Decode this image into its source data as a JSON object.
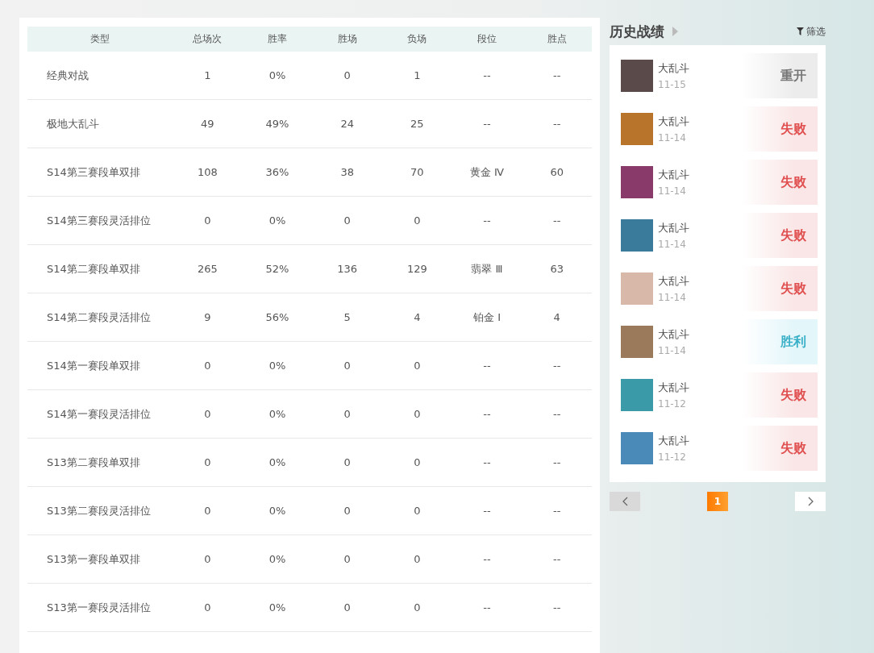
{
  "table": {
    "columns": [
      "类型",
      "总场次",
      "胜率",
      "胜场",
      "负场",
      "段位",
      "胜点"
    ],
    "rows": [
      [
        "经典对战",
        "1",
        "0%",
        "0",
        "1",
        "--",
        "--"
      ],
      [
        "极地大乱斗",
        "49",
        "49%",
        "24",
        "25",
        "--",
        "--"
      ],
      [
        "S14第三赛段单双排",
        "108",
        "36%",
        "38",
        "70",
        "黄金 Ⅳ",
        "60"
      ],
      [
        "S14第三赛段灵活排位",
        "0",
        "0%",
        "0",
        "0",
        "--",
        "--"
      ],
      [
        "S14第二赛段单双排",
        "265",
        "52%",
        "136",
        "129",
        "翡翠 Ⅲ",
        "63"
      ],
      [
        "S14第二赛段灵活排位",
        "9",
        "56%",
        "5",
        "4",
        "铂金 Ⅰ",
        "4"
      ],
      [
        "S14第一赛段单双排",
        "0",
        "0%",
        "0",
        "0",
        "--",
        "--"
      ],
      [
        "S14第一赛段灵活排位",
        "0",
        "0%",
        "0",
        "0",
        "--",
        "--"
      ],
      [
        "S13第二赛段单双排",
        "0",
        "0%",
        "0",
        "0",
        "--",
        "--"
      ],
      [
        "S13第二赛段灵活排位",
        "0",
        "0%",
        "0",
        "0",
        "--",
        "--"
      ],
      [
        "S13第一赛段单双排",
        "0",
        "0%",
        "0",
        "0",
        "--",
        "--"
      ],
      [
        "S13第一赛段灵活排位",
        "0",
        "0%",
        "0",
        "0",
        "--",
        "--"
      ]
    ]
  },
  "history": {
    "title": "历史战绩",
    "filter": "筛选",
    "matches": [
      {
        "mode": "大乱斗",
        "date": "11-15",
        "result": "重开",
        "kind": "remake",
        "color": "#5a4a4a"
      },
      {
        "mode": "大乱斗",
        "date": "11-14",
        "result": "失败",
        "kind": "loss",
        "color": "#b8742a"
      },
      {
        "mode": "大乱斗",
        "date": "11-14",
        "result": "失败",
        "kind": "loss",
        "color": "#8a3a6a"
      },
      {
        "mode": "大乱斗",
        "date": "11-14",
        "result": "失败",
        "kind": "loss",
        "color": "#3a7a9a"
      },
      {
        "mode": "大乱斗",
        "date": "11-14",
        "result": "失败",
        "kind": "loss",
        "color": "#d8b8a8"
      },
      {
        "mode": "大乱斗",
        "date": "11-14",
        "result": "胜利",
        "kind": "win",
        "color": "#9a7a5a"
      },
      {
        "mode": "大乱斗",
        "date": "11-12",
        "result": "失败",
        "kind": "loss",
        "color": "#3a9aa8"
      },
      {
        "mode": "大乱斗",
        "date": "11-12",
        "result": "失败",
        "kind": "loss",
        "color": "#4a8ab8"
      }
    ],
    "pages": [
      {
        "label": "1",
        "selected": true
      }
    ]
  }
}
